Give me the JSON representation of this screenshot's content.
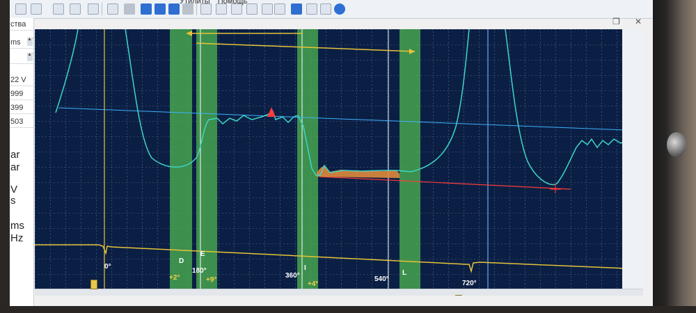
{
  "menu": {
    "items": [
      "Утилиты",
      "Помощь"
    ]
  },
  "window": {
    "restore_icon": "restore-icon",
    "close_icon": "close-icon",
    "restore_glyph": "❐",
    "close_glyph": "✕"
  },
  "side_panel": {
    "rows": [
      "ства",
      "ms",
      "",
      "22 V",
      "999",
      "399",
      "503",
      "ar",
      "ar",
      "V",
      "s",
      "ms",
      "Hz"
    ]
  },
  "channels": {
    "ch1": "1",
    "ch2": "2"
  },
  "markers": {
    "zones": [
      "D",
      "E",
      "I",
      "L"
    ],
    "angles": [
      "0°",
      "180°",
      "360°",
      "540°",
      "720°"
    ],
    "offsets": [
      "+2°",
      "+9°",
      "+4°"
    ]
  },
  "colors": {
    "background": "#0b1f45",
    "grid": "#ffffff",
    "trace_cyan": "#3fd6c8",
    "trace_yellow": "#e8c33a",
    "zone_green": "#4caf50",
    "cursor_line": "#6aa8ff",
    "highlight_red": "#ff3b3b",
    "fill_orange": "#e08a3c"
  }
}
